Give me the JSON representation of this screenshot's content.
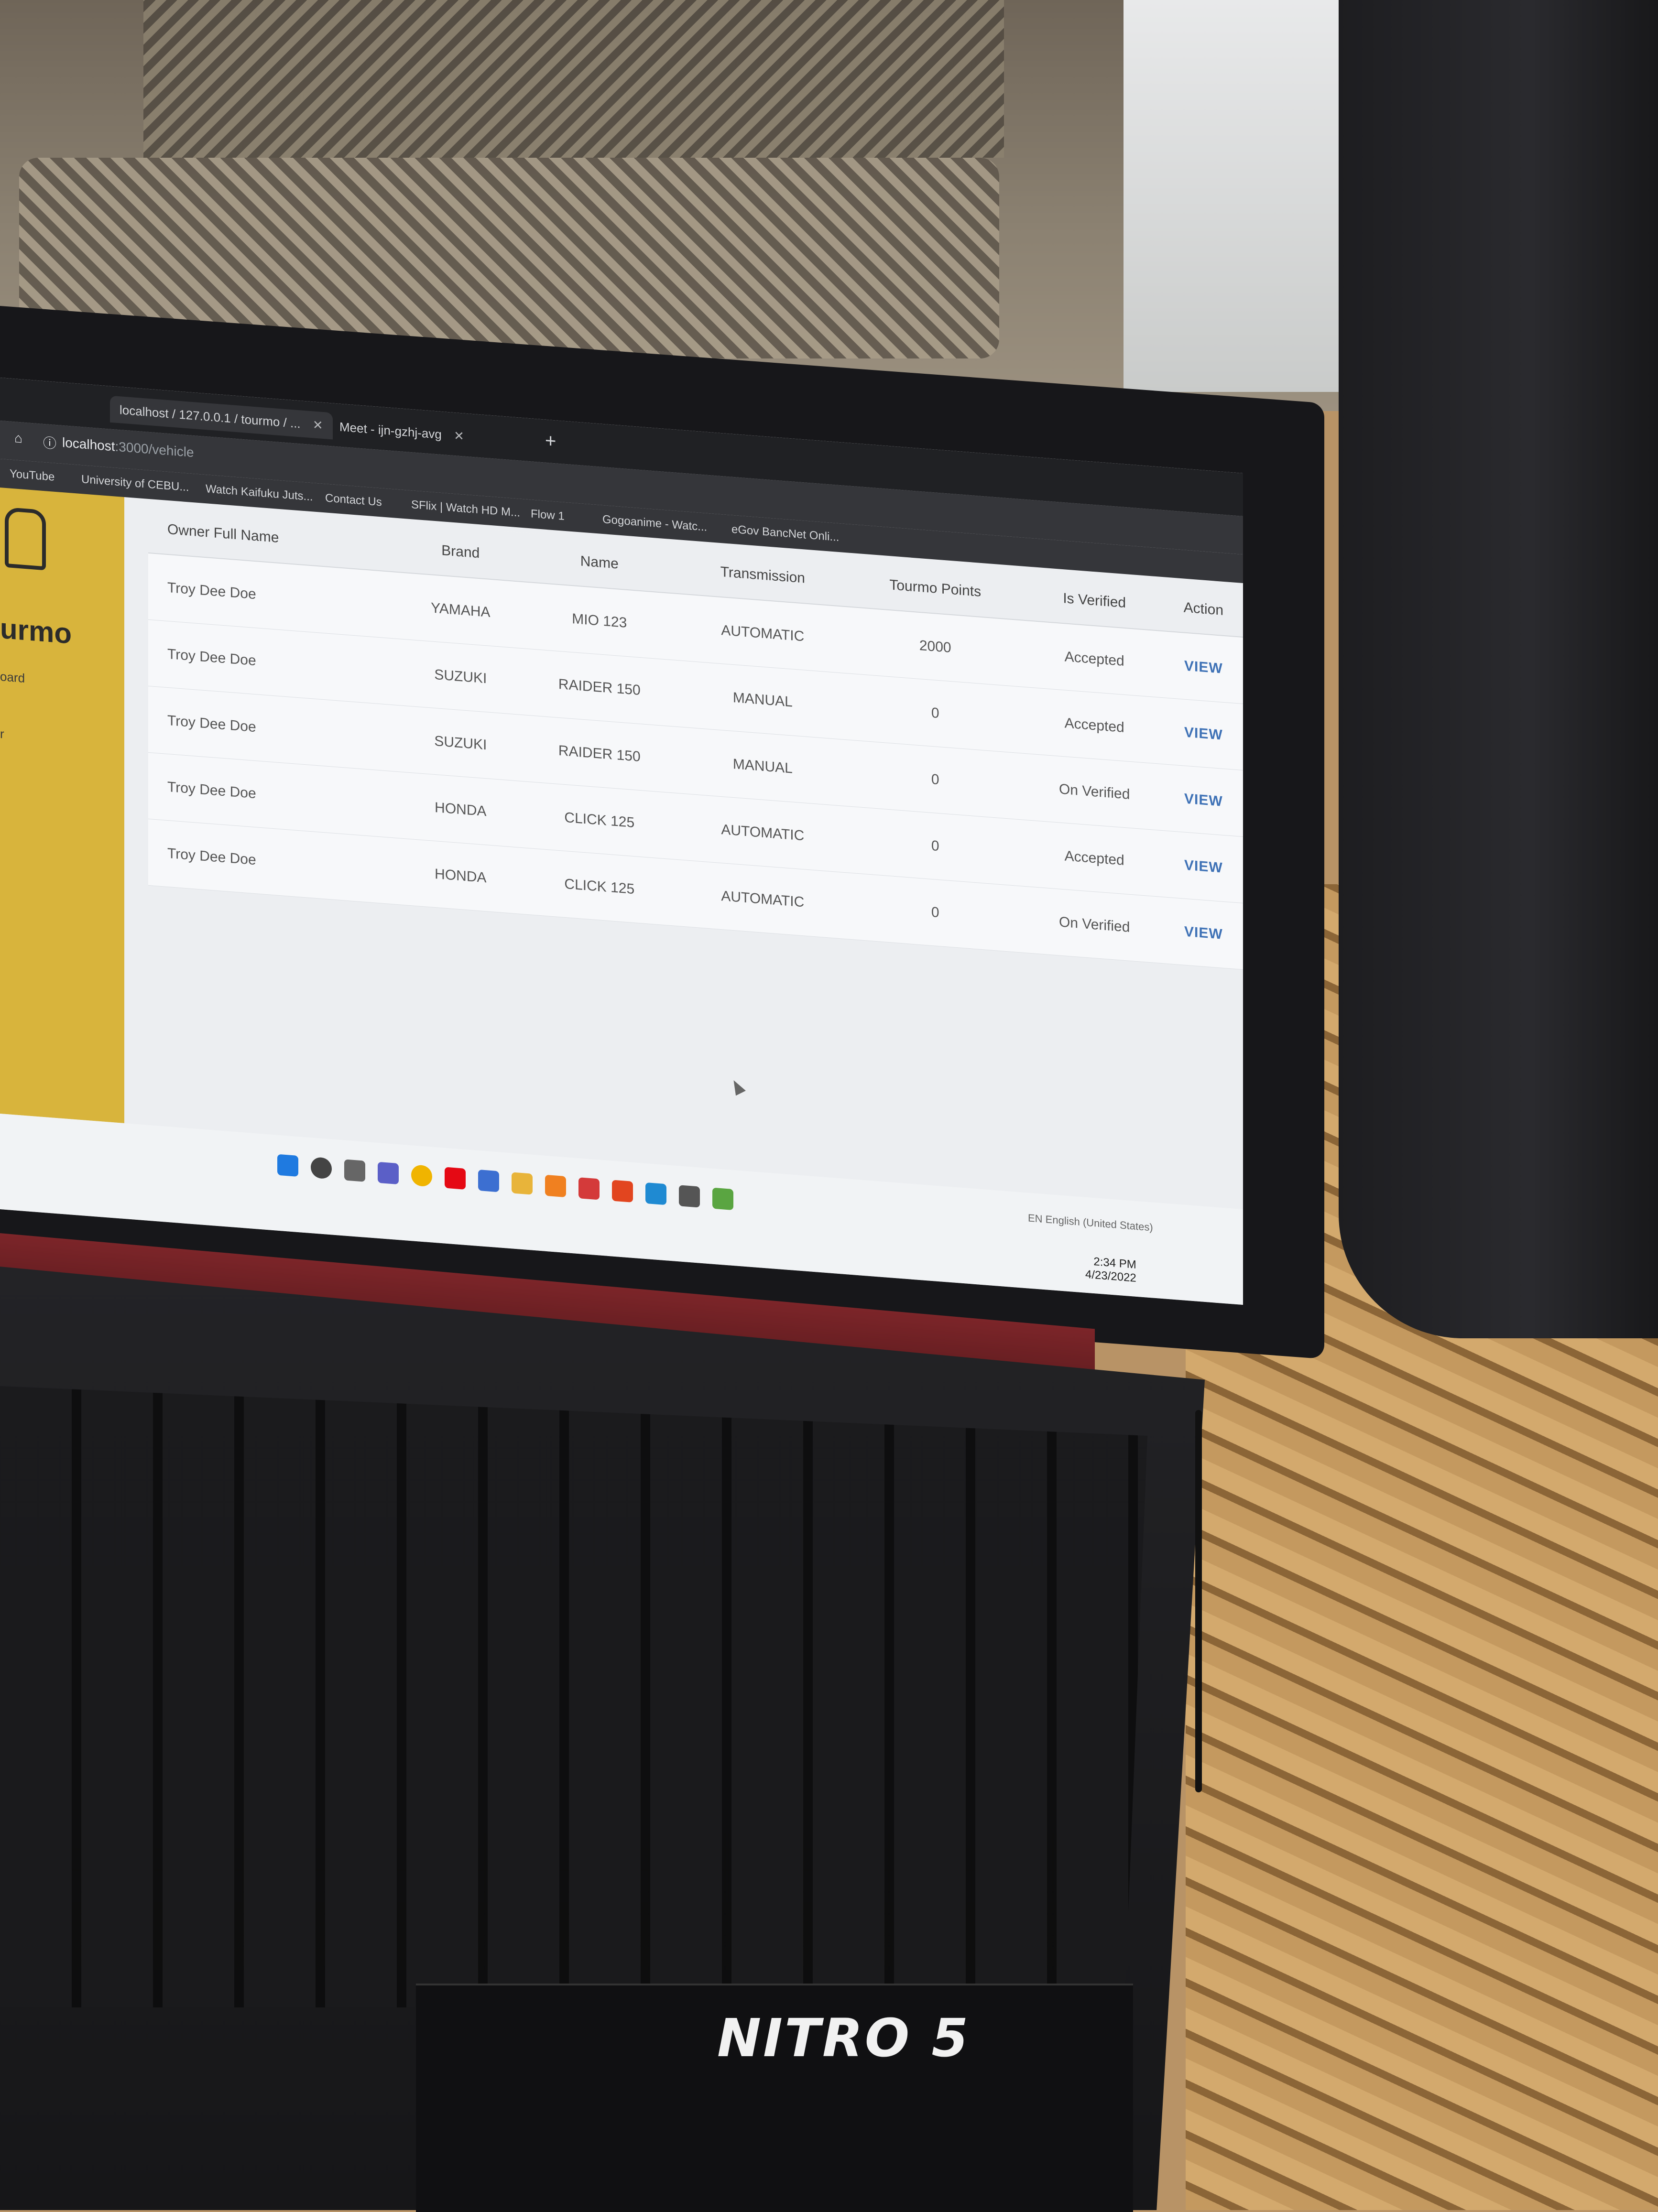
{
  "browser": {
    "tabs": [
      {
        "title": "localhost / 127.0.0.1 / tourmo / ..."
      },
      {
        "title": "Meet - ijn-gzhj-avg"
      }
    ],
    "url_host": "localhost",
    "url_path": ":3000/vehicle",
    "bookmarks": [
      "YouTube",
      "University of CEBU...",
      "Watch Kaifuku Juts...",
      "Contact Us",
      "SFlix | Watch HD M...",
      "Flow 1",
      "Gogoanime - Watc...",
      "eGov BancNet Onli..."
    ]
  },
  "sidebar": {
    "logo_text": "urmo",
    "links": [
      "oard",
      "r"
    ]
  },
  "table": {
    "headers": [
      "Owner Full Name",
      "Brand",
      "Name",
      "Transmission",
      "Tourmo Points",
      "Is Verified",
      "Action"
    ],
    "rows": [
      {
        "owner": "Troy Dee Doe",
        "brand": "YAMAHA",
        "name": "MIO 123",
        "transmission": "AUTOMATIC",
        "points": "2000",
        "verified": "Accepted",
        "action": "VIEW"
      },
      {
        "owner": "Troy Dee Doe",
        "brand": "SUZUKI",
        "name": "RAIDER 150",
        "transmission": "MANUAL",
        "points": "0",
        "verified": "Accepted",
        "action": "VIEW"
      },
      {
        "owner": "Troy Dee Doe",
        "brand": "SUZUKI",
        "name": "RAIDER 150",
        "transmission": "MANUAL",
        "points": "0",
        "verified": "On Verified",
        "action": "VIEW"
      },
      {
        "owner": "Troy Dee Doe",
        "brand": "HONDA",
        "name": "CLICK 125",
        "transmission": "AUTOMATIC",
        "points": "0",
        "verified": "Accepted",
        "action": "VIEW"
      },
      {
        "owner": "Troy Dee Doe",
        "brand": "HONDA",
        "name": "CLICK 125",
        "transmission": "AUTOMATIC",
        "points": "0",
        "verified": "On Verified",
        "action": "VIEW"
      }
    ]
  },
  "taskbar": {
    "language": "EN English (United States)",
    "time": "2:34 PM",
    "date": "4/23/2022"
  },
  "laptop": {
    "model_badge": "NITRO 5"
  },
  "colors": {
    "sidebar": "#d8b43c",
    "link": "#3f72b6",
    "hinge": "#7c2529"
  }
}
